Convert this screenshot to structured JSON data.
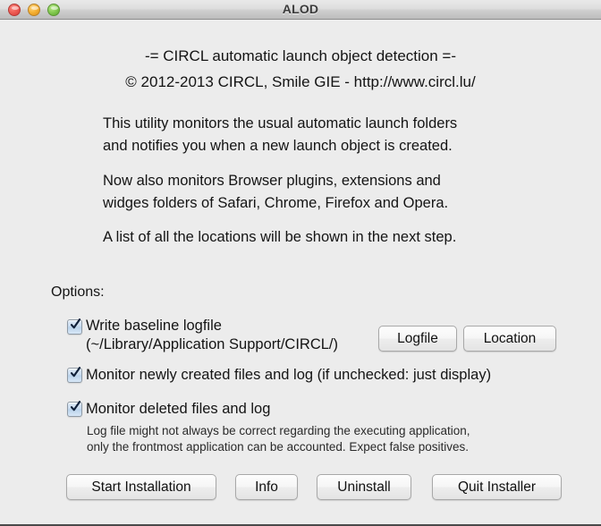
{
  "window": {
    "title": "ALOD",
    "traffic_lights": [
      {
        "name": "close-button",
        "color": "#ef5f56"
      },
      {
        "name": "minimize-button",
        "color": "#f6b336"
      },
      {
        "name": "zoom-button",
        "color": "#88cc55"
      }
    ]
  },
  "header": {
    "headline": "-= CIRCL automatic launch object detection =-",
    "copyright": "© 2012-2013 CIRCL, Smile GIE - http://www.circl.lu/"
  },
  "description": {
    "paragraph1": "This utility monitors the usual automatic launch folders\nand notifies you when a new launch object is created.",
    "paragraph2": "Now also monitors Browser plugins, extensions and\nwidges folders of Safari, Chrome, Firefox and Opera.",
    "paragraph3": "A list of all the locations will be shown in the next step."
  },
  "options": {
    "label": "Options:",
    "items": [
      {
        "name": "write-baseline-logfile",
        "label": "Write baseline logfile\n(~/Library/Application Support/CIRCL/)",
        "checked": true
      },
      {
        "name": "monitor-created-files",
        "label": "Monitor newly created files and log (if unchecked: just display)",
        "checked": true
      },
      {
        "name": "monitor-deleted-files",
        "label": "Monitor deleted files and log",
        "checked": true
      }
    ],
    "logfile_button": "Logfile",
    "location_button": "Location",
    "note": "Log file might not always be correct regarding the executing application,\nonly the frontmost application can be accounted. Expect false positives."
  },
  "actions": {
    "start": "Start Installation",
    "info": "Info",
    "uninstall": "Uninstall",
    "quit": "Quit Installer"
  },
  "colors": {
    "window_background": "#ececec",
    "checkbox_fill": "#c6daee",
    "text": "#141414"
  }
}
